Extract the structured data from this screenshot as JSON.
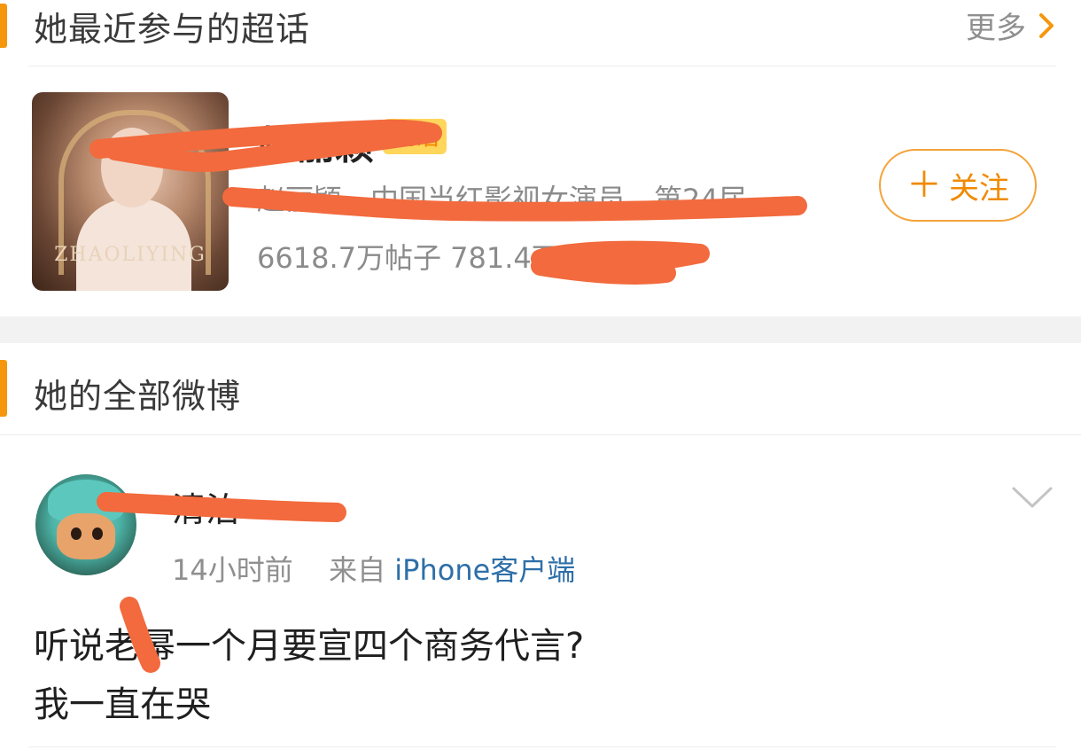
{
  "supertopic_section": {
    "title": "她最近参与的超话",
    "more_label": "更多",
    "topic": {
      "name": "赵丽颖",
      "tag": "超话",
      "cover_text": "ZHAOLIYING",
      "description": "赵丽颖，中国当红影视女演员，第24届",
      "stats": "6618.7万帖子 781.4万",
      "follow_label": "关注",
      "follow_icon": "plus-icon"
    }
  },
  "weibo_section": {
    "title": "她的全部微博",
    "post": {
      "username": "清泊",
      "time": "14小时前",
      "from_label": "来自",
      "source": "iPhone客户端",
      "text_lines": [
        "听说老幂一个月要宣四个商务代言?",
        "我一直在哭"
      ]
    }
  },
  "colors": {
    "accent": "#f5960c",
    "follow": "#f08a00",
    "link": "#2e6fa8",
    "redaction": "#f26a3d"
  }
}
